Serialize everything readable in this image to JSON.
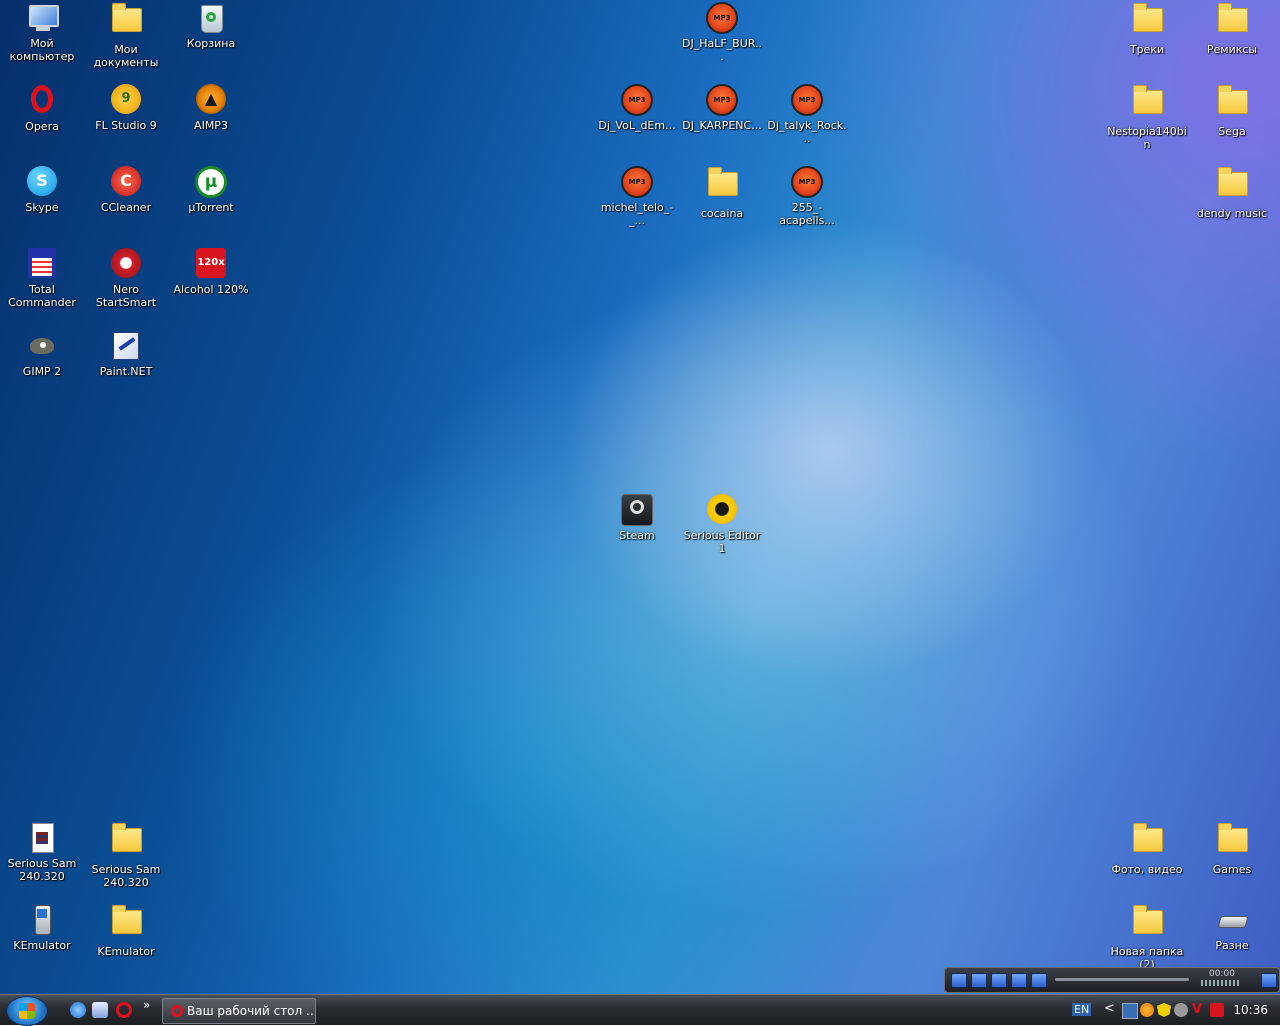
{
  "desktop": {
    "icons": {
      "my_computer": "Мой компьютер",
      "my_documents": "Мои документы",
      "recycle_bin": "Корзина",
      "opera": "Opera",
      "fl_studio": "FL Studio 9",
      "aimp3": "AIMP3",
      "skype": "Skype",
      "ccleaner": "CCleaner",
      "utorrent": "µTorrent",
      "total_commander": "Total Commander",
      "nero": "Nero StartSmart",
      "alcohol": "Alcohol 120%",
      "gimp": "GIMP 2",
      "paintnet": "Paint.NET",
      "dj_half": "DJ_HaLF_BUR...",
      "dj_vol": "Dj_VoL_dEm...",
      "dj_karpenc": "DJ_KARPENC...",
      "dj_talyk": "Dj_talyk_Rock...",
      "michel": "michel_telo_-_...",
      "cocaina": "cocaina",
      "acapells": "255_-acapells...",
      "treki": "Треки",
      "remixes": "Ремиксы",
      "nestopia": "Nestopia140bin",
      "sega": "Sega",
      "dendy": "dendy music",
      "steam": "Steam",
      "serious_editor": "Serious Editor 1",
      "serious_sam_file": "Serious Sam 240.320",
      "serious_sam_folder": "Serious Sam 240.320",
      "kemulator_app": "KEmulator",
      "kemulator_folder": "KEmulator",
      "photo_video": "Фото, видео",
      "games": "Games",
      "new_folder": "Новая папка (2)",
      "razne": "Разне",
      "mp3_badge": "MP3",
      "alcohol_badge": "120x"
    }
  },
  "mediabar": {
    "time": "00:00"
  },
  "taskbar": {
    "quicklaunch_more": "»",
    "window_button": "Ваш рабочий стол ...",
    "language": "EN",
    "tray_expand": "<",
    "clock": "10:36"
  },
  "colors": {
    "taskbar": "#2a2e34",
    "opera_red": "#e0101a",
    "folder_yellow": "#f5c93e",
    "mp3_orange": "#e2431a"
  }
}
